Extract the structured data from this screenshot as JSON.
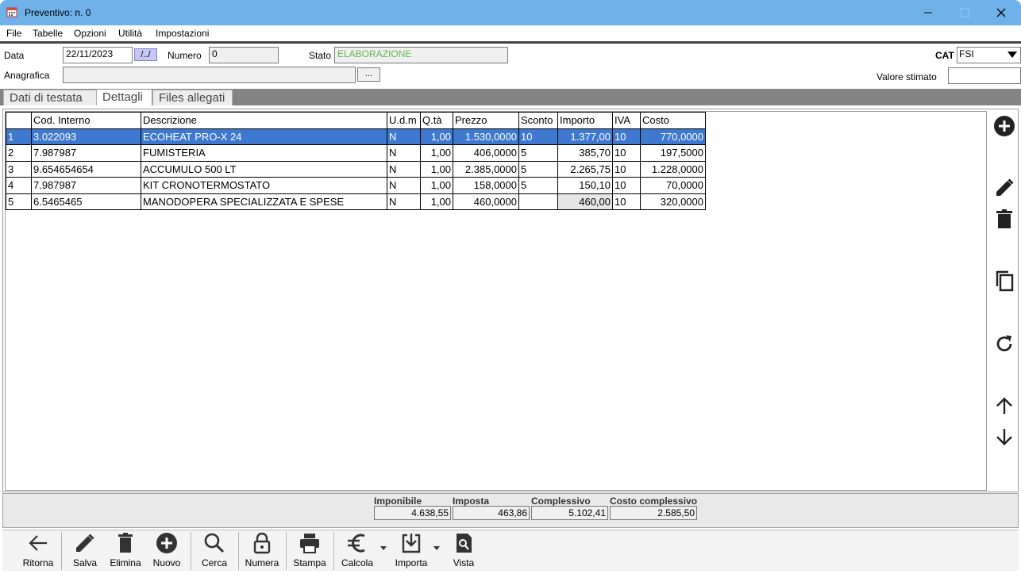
{
  "window": {
    "title": "Preventivo: n. 0",
    "icon": "calendar-icon"
  },
  "menu": [
    "File",
    "Tabelle",
    "Opzioni",
    "Utilità",
    "Impostazioni"
  ],
  "header": {
    "data_label": "Data",
    "data_value": "22/11/2023",
    "date_button": "/../",
    "numero_label": "Numero",
    "numero_value": "0",
    "stato_label": "Stato",
    "stato_value": "ELABORAZIONE",
    "cat_label": "CAT",
    "cat_value": "FSI",
    "anagrafica_label": "Anagrafica",
    "anagrafica_value": "",
    "anagrafica_button": "...",
    "valore_label": "Valore stimato",
    "valore_value": ""
  },
  "tabs": [
    "Dati di testata",
    "Dettagli",
    "Files allegati"
  ],
  "grid": {
    "columns": [
      "",
      "Cod. Interno",
      "Descrizione",
      "U.d.m",
      "Q.tà",
      "Prezzo",
      "Sconto",
      "Importo",
      "IVA",
      "Costo"
    ],
    "rows": [
      [
        "1",
        "3.022093",
        "ECOHEAT PRO-X 24",
        "N",
        "1,00",
        "1.530,0000",
        "10",
        "1.377,00",
        "10",
        "770,0000"
      ],
      [
        "2",
        "7.987987",
        "FUMISTERIA",
        "N",
        "1,00",
        "406,0000",
        "5",
        "385,70",
        "10",
        "197,5000"
      ],
      [
        "3",
        "9.654654654",
        "ACCUMULO 500 LT",
        "N",
        "1,00",
        "2.385,0000",
        "5",
        "2.265,75",
        "10",
        "1.228,0000"
      ],
      [
        "4",
        "7.987987",
        "KIT CRONOTERMOSTATO",
        "N",
        "1,00",
        "158,0000",
        "5",
        "150,10",
        "10",
        "70,0000"
      ],
      [
        "5",
        "6.5465465",
        "MANODOPERA SPECIALIZZATA E SPESE",
        "N",
        "1,00",
        "460,0000",
        "",
        "460,00",
        "10",
        "320,0000"
      ]
    ],
    "selected_row": 0
  },
  "side_icons": [
    "add-icon",
    "edit-icon",
    "delete-icon",
    "copy-icon",
    "refresh-icon",
    "arrow-up-icon",
    "arrow-down-icon"
  ],
  "totals": {
    "imponibile_label": "Imponibile",
    "imponibile": "4.638,55",
    "imposta_label": "Imposta",
    "imposta": "463,86",
    "complessivo_label": "Complessivo",
    "complessivo": "5.102,41",
    "costo_label": "Costo complessivo",
    "costo": "2.585,50"
  },
  "toolbar": [
    {
      "label": "Ritorna",
      "icon": "arrow-left-icon"
    },
    {
      "label": "Salva",
      "icon": "pencil-icon"
    },
    {
      "label": "Elimina",
      "icon": "trash-icon"
    },
    {
      "label": "Nuovo",
      "icon": "plus-circle-icon"
    },
    {
      "label": "Cerca",
      "icon": "search-icon"
    },
    {
      "label": "Numera",
      "icon": "lock-icon"
    },
    {
      "label": "Stampa",
      "icon": "printer-icon"
    },
    {
      "label": "Calcola",
      "icon": "euro-icon"
    },
    {
      "label": "Importa",
      "icon": "import-icon"
    },
    {
      "label": "Vista",
      "icon": "preview-icon"
    }
  ],
  "colors": {
    "titlebar": "#6fb2e9",
    "selection": "#3f79cf",
    "stato_text": "#5dbb4a"
  }
}
